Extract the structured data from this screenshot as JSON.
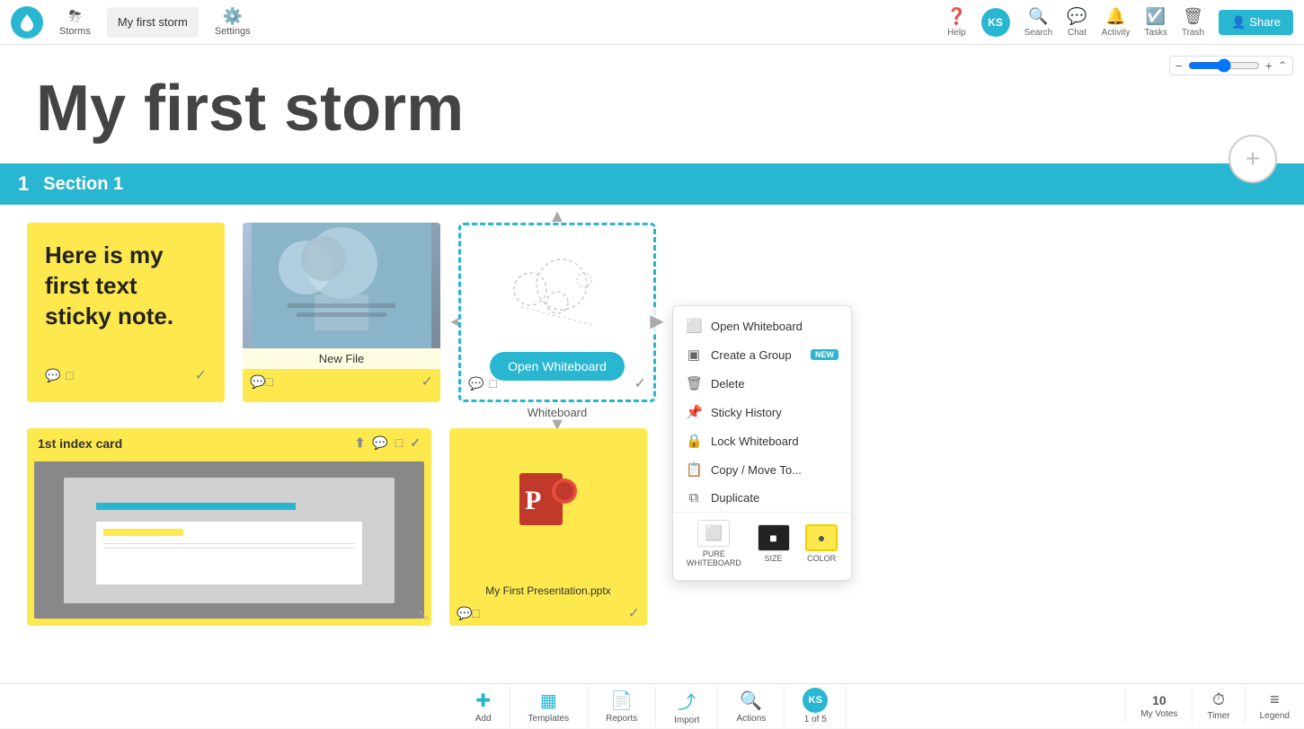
{
  "navbar": {
    "logo_icon": "💧",
    "storms_label": "Storms",
    "current_tab": "My first storm",
    "settings_label": "Settings",
    "help_label": "Help",
    "avatar_initials": "KS",
    "search_label": "Search",
    "chat_label": "Chat",
    "activity_label": "Activity",
    "tasks_label": "Tasks",
    "trash_label": "Trash",
    "share_label": "Share"
  },
  "page": {
    "title": "My first storm"
  },
  "section": {
    "number": "1",
    "title": "Section 1"
  },
  "cards": [
    {
      "id": "sticky",
      "type": "sticky",
      "text": "Here is my first text sticky note."
    },
    {
      "id": "file",
      "type": "file",
      "label": "New File"
    },
    {
      "id": "whiteboard",
      "type": "whiteboard",
      "btn_label": "Open Whiteboard",
      "label": "Whiteboard"
    },
    {
      "id": "index",
      "type": "index",
      "label": "1st index card"
    },
    {
      "id": "pptx",
      "type": "pptx",
      "label": "My First Presentation.pptx"
    }
  ],
  "context_menu": {
    "items": [
      {
        "icon": "⬜",
        "label": "Open Whiteboard",
        "badge": ""
      },
      {
        "icon": "▣",
        "label": "Create a Group",
        "badge": "NEW"
      },
      {
        "icon": "🗑",
        "label": "Delete",
        "badge": ""
      },
      {
        "icon": "📌",
        "label": "Sticky History",
        "badge": ""
      },
      {
        "icon": "🔒",
        "label": "Lock Whiteboard",
        "badge": ""
      },
      {
        "icon": "📋",
        "label": "Copy / Move To...",
        "badge": ""
      },
      {
        "icon": "⧉",
        "label": "Duplicate",
        "badge": ""
      }
    ],
    "tools": [
      {
        "id": "pure-whiteboard",
        "label": "PURE\nWHITEBOARD",
        "style": "white"
      },
      {
        "id": "size",
        "label": "SIZE",
        "style": "black"
      },
      {
        "id": "color",
        "label": "COLOR",
        "style": "yellow"
      }
    ]
  },
  "bottom_toolbar": {
    "items": [
      {
        "id": "add",
        "icon": "➕",
        "label": "Add"
      },
      {
        "id": "templates",
        "icon": "▦",
        "label": "Templates"
      },
      {
        "id": "reports",
        "icon": "📄",
        "label": "Reports"
      },
      {
        "id": "import",
        "icon": "⤴",
        "label": "Import"
      },
      {
        "id": "actions",
        "icon": "🔍",
        "label": "Actions"
      }
    ],
    "user": {
      "initials": "KS",
      "count": "1 of 5"
    }
  },
  "bottom_right": {
    "items": [
      {
        "id": "my-votes",
        "icon": "10",
        "label": "My Votes"
      },
      {
        "id": "timer",
        "icon": "⏱",
        "label": "Timer"
      },
      {
        "id": "legend",
        "icon": "≡",
        "label": "Legend"
      }
    ]
  },
  "zoom": {
    "minus": "−",
    "plus": "+"
  }
}
